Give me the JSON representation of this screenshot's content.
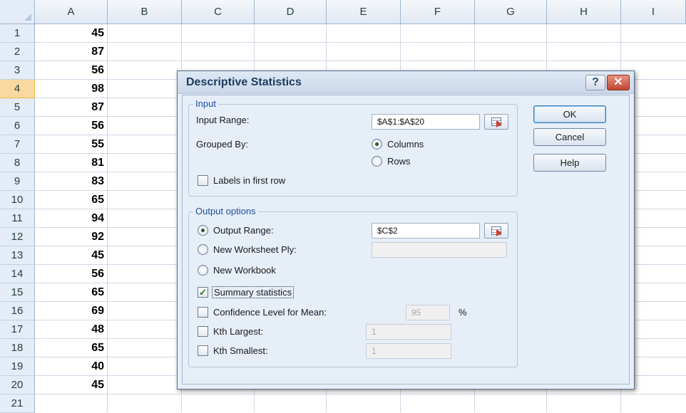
{
  "spreadsheet": {
    "columns": [
      "A",
      "B",
      "C",
      "D",
      "E",
      "F",
      "G",
      "H",
      "I"
    ],
    "rows": [
      "1",
      "2",
      "3",
      "4",
      "5",
      "6",
      "7",
      "8",
      "9",
      "10",
      "11",
      "12",
      "13",
      "14",
      "15",
      "16",
      "17",
      "18",
      "19",
      "20",
      "21"
    ],
    "active_row": "4",
    "column_a_values": [
      "45",
      "87",
      "56",
      "98",
      "87",
      "56",
      "55",
      "81",
      "83",
      "65",
      "94",
      "92",
      "45",
      "56",
      "65",
      "69",
      "48",
      "65",
      "40",
      "45"
    ]
  },
  "dialog": {
    "title": "Descriptive Statistics",
    "help_icon": "?",
    "input_group": {
      "legend": "Input",
      "input_range_label": "Input Range:",
      "input_range_value": "$A$1:$A$20",
      "grouped_by_label": "Grouped By:",
      "columns_label": "Columns",
      "rows_label": "Rows",
      "grouped_by_selected": "Columns",
      "labels_first_row_label": "Labels in first row",
      "labels_first_row_checked": false
    },
    "output_group": {
      "legend": "Output options",
      "output_range_label": "Output Range:",
      "output_range_value": "$C$2",
      "new_worksheet_label": "New Worksheet Ply:",
      "new_worksheet_value": "",
      "new_workbook_label": "New Workbook",
      "selected_option": "Output Range",
      "summary_statistics_label": "Summary statistics",
      "summary_statistics_checked": true,
      "confidence_label": "Confidence Level for Mean:",
      "confidence_value": "95",
      "confidence_unit": "%",
      "kth_largest_label": "Kth Largest:",
      "kth_largest_value": "1",
      "kth_smallest_label": "Kth Smallest:",
      "kth_smallest_value": "1"
    },
    "buttons": {
      "ok": "OK",
      "cancel": "Cancel",
      "help": "Help"
    }
  },
  "colors": {
    "accent": "#1e4e9c",
    "close": "#c24632",
    "active_row": "#f9d99f"
  }
}
